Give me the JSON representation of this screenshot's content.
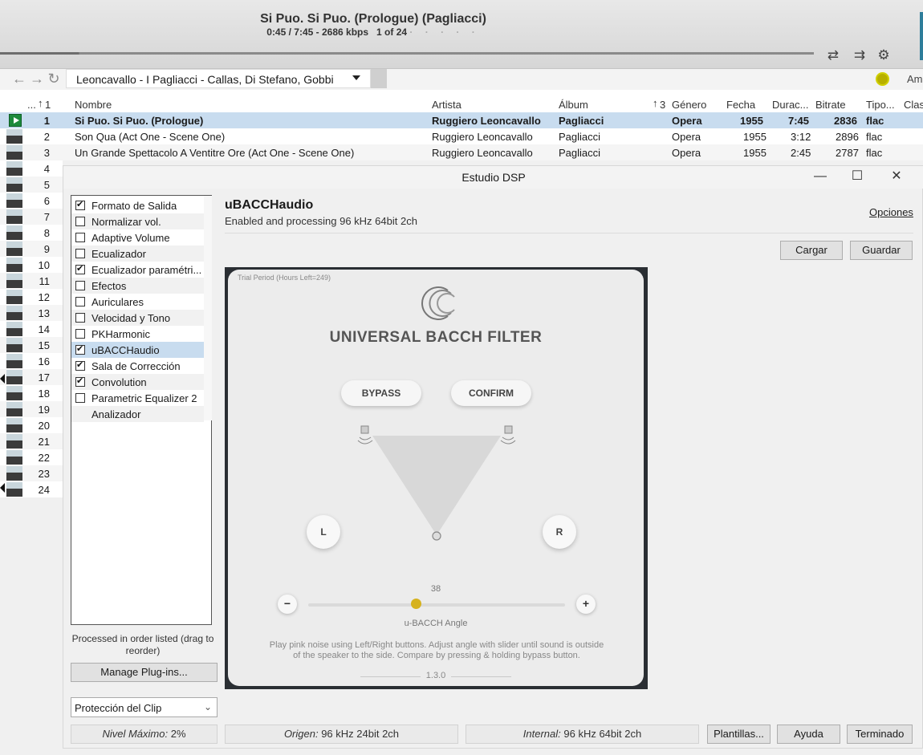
{
  "player": {
    "title": "Si Puo. Si Puo. (Prologue) (Pagliacci)",
    "position": "0:45 / 7:45",
    "bitrate": "2686 kbps",
    "track_of": "1 of 24",
    "progress_fraction": 0.097
  },
  "nav": {
    "playlist": "Leoncavallo - I Pagliacci - Callas, Di Stefano, Gobbi",
    "right_text": "Am"
  },
  "table": {
    "headers": {
      "index": "...",
      "sort1": "1",
      "name": "Nombre",
      "artist": "Artista",
      "album": "Álbum",
      "sort3": "3",
      "genre": "Género",
      "date": "Fecha",
      "duration": "Durac...",
      "bitrate": "Bitrate",
      "type": "Tipo...",
      "class": "Clas"
    },
    "rows": [
      {
        "n": "1",
        "name": "Si Puo. Si Puo. (Prologue)",
        "artist": "Ruggiero Leoncavallo",
        "album": "Pagliacci",
        "genre": "Opera",
        "date": "1955",
        "dur": "7:45",
        "bitrate": "2836",
        "type": "flac"
      },
      {
        "n": "2",
        "name": "Son Qua (Act One - Scene One)",
        "artist": "Ruggiero Leoncavallo",
        "album": "Pagliacci",
        "genre": "Opera",
        "date": "1955",
        "dur": "3:12",
        "bitrate": "2896",
        "type": "flac"
      },
      {
        "n": "3",
        "name": "Un Grande Spettacolo A Ventitre Ore (Act One - Scene One)",
        "artist": "Ruggiero Leoncavallo",
        "album": "Pagliacci",
        "genre": "Opera",
        "date": "1955",
        "dur": "2:45",
        "bitrate": "2787",
        "type": "flac"
      }
    ],
    "more_numbers": [
      "4",
      "5",
      "6",
      "7",
      "8",
      "9",
      "10",
      "11",
      "12",
      "13",
      "14",
      "15",
      "16",
      "17",
      "18",
      "19",
      "20",
      "21",
      "22",
      "23",
      "24"
    ]
  },
  "dsp": {
    "window_title": "Estudio DSP",
    "plugins": [
      {
        "label": "Formato de Salida",
        "checked": true
      },
      {
        "label": "Normalizar vol.",
        "checked": false
      },
      {
        "label": "Adaptive Volume",
        "checked": false
      },
      {
        "label": "Ecualizador",
        "checked": false
      },
      {
        "label": "Ecualizador paramétri...",
        "checked": true
      },
      {
        "label": "Efectos",
        "checked": false
      },
      {
        "label": "Auriculares",
        "checked": false
      },
      {
        "label": "Velocidad y Tono",
        "checked": false
      },
      {
        "label": "PKHarmonic",
        "checked": false
      },
      {
        "label": "uBACCHaudio",
        "checked": true
      },
      {
        "label": "Sala de Corrección",
        "checked": true
      },
      {
        "label": "Convolution",
        "checked": true
      },
      {
        "label": "Parametric Equalizer 2",
        "checked": false
      },
      {
        "label": "Analizador",
        "checked": null
      }
    ],
    "selected_plugin": "uBACCHaudio",
    "order_note": "Processed in order listed (drag to reorder)",
    "manage_button": "Manage Plug-ins...",
    "clip_select": "Protección del Clip",
    "plugin_name": "uBACCHaudio",
    "plugin_status": "Enabled and processing 96 kHz 64bit 2ch",
    "options_link": "Opciones",
    "load_button": "Cargar",
    "save_button": "Guardar",
    "status": {
      "peak_label": "Nivel Máximo:",
      "peak_value": "2%",
      "source_label": "Origen:",
      "source_value": "96 kHz 24bit 2ch",
      "internal_label": "Internal:",
      "internal_value": "96 kHz 64bit 2ch"
    },
    "templates_button": "Plantillas...",
    "help_button": "Ayuda",
    "done_button": "Terminado"
  },
  "bacch": {
    "trial": "Trial Period (Hours Left=249)",
    "title": "UNIVERSAL BACCH FILTER",
    "bypass": "BYPASS",
    "confirm": "CONFIRM",
    "left": "L",
    "right": "R",
    "minus": "−",
    "plus": "+",
    "angle_value": "38",
    "angle_label": "u-BACCH Angle",
    "angle_fraction": 0.42,
    "instructions": "Play pink noise using Left/Right buttons. Adjust angle with slider until sound is outside of the speaker to the side. Compare by pressing & holding bypass button.",
    "version": "1.3.0"
  },
  "colors": {
    "selection": "#c8dcef",
    "play_green": "#1d8a3c",
    "slider_knob": "#d6b21e",
    "status_dot": "#b8b000"
  }
}
